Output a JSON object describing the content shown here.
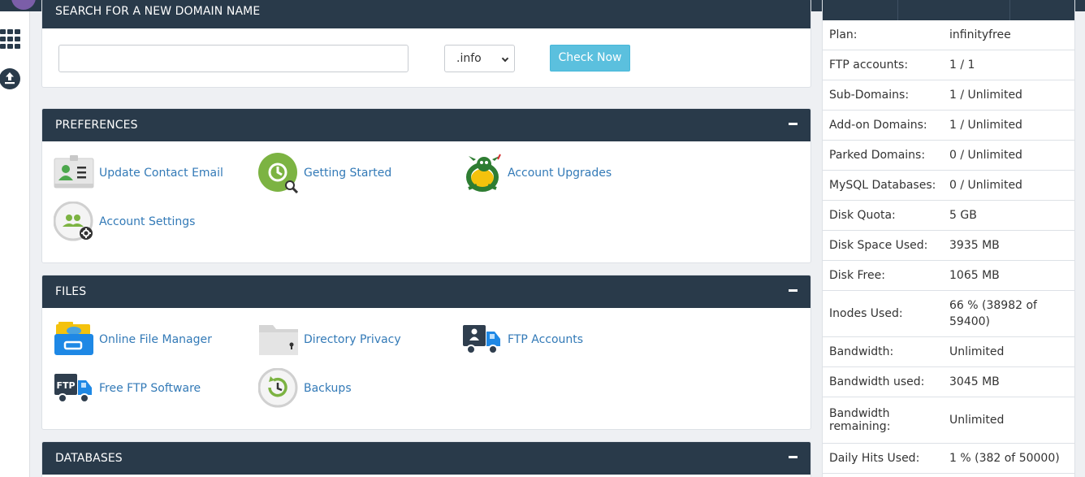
{
  "search": {
    "heading": "SEARCH FOR A NEW DOMAIN NAME",
    "input_value": "",
    "tld_selected": ".info",
    "button_label": "Check Now"
  },
  "preferences": {
    "heading": "PREFERENCES",
    "items": [
      {
        "label": "Update Contact Email",
        "icon": "contact-card-icon"
      },
      {
        "label": "Getting Started",
        "icon": "getting-started-icon"
      },
      {
        "label": "Account Upgrades",
        "icon": "dragon-mascot-icon"
      },
      {
        "label": "Account Settings",
        "icon": "account-settings-icon"
      }
    ]
  },
  "files": {
    "heading": "FILES",
    "items": [
      {
        "label": "Online File Manager",
        "icon": "file-manager-icon"
      },
      {
        "label": "Directory Privacy",
        "icon": "locked-folder-icon"
      },
      {
        "label": "FTP Accounts",
        "icon": "ftp-accounts-icon"
      },
      {
        "label": "Free FTP Software",
        "icon": "ftp-truck-icon"
      },
      {
        "label": "Backups",
        "icon": "backups-icon"
      }
    ]
  },
  "databases": {
    "heading": "DATABASES"
  },
  "stats": [
    {
      "key": "Plan:",
      "value": "infinityfree"
    },
    {
      "key": "FTP accounts:",
      "value": "1 / 1"
    },
    {
      "key": "Sub-Domains:",
      "value": "1 / Unlimited"
    },
    {
      "key": "Add-on Domains:",
      "value": "1 / Unlimited"
    },
    {
      "key": "Parked Domains:",
      "value": "0 / Unlimited"
    },
    {
      "key": "MySQL Databases:",
      "value": "0 / Unlimited"
    },
    {
      "key": "Disk Quota:",
      "value": "5 GB"
    },
    {
      "key": "Disk Space Used:",
      "value": "3935 MB"
    },
    {
      "key": "Disk Free:",
      "value": "1065 MB"
    },
    {
      "key": "Inodes Used:",
      "value": "66 % (38982 of 59400)"
    },
    {
      "key": "Bandwidth:",
      "value": "Unlimited"
    },
    {
      "key": "Bandwidth used:",
      "value": "3045 MB"
    },
    {
      "key": "Bandwidth remaining:",
      "value": "Unlimited"
    },
    {
      "key": "Daily Hits Used:",
      "value": "1 % (382 of 50000)"
    }
  ],
  "colors": {
    "header": "#293a4a",
    "link": "#337ab7",
    "button": "#5bc0de"
  }
}
